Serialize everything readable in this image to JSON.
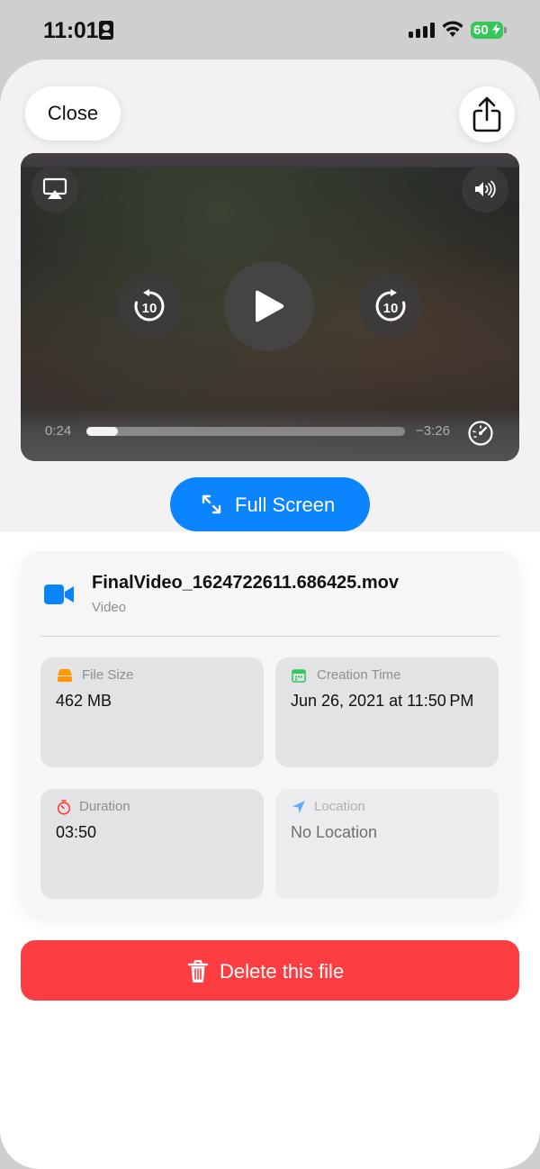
{
  "status_bar": {
    "time": "11:01",
    "battery": "60"
  },
  "header": {
    "close_label": "Close"
  },
  "player": {
    "current_time": "0:24",
    "remaining_time": "−3:26",
    "progress": 0.1,
    "skip_back_seconds": "10",
    "skip_forward_seconds": "10"
  },
  "fullscreen_label": "Full Screen",
  "file": {
    "name": "FinalVideo_1624722611.686425.mov",
    "type": "Video"
  },
  "info": {
    "file_size": {
      "label": "File Size",
      "value": "462 MB"
    },
    "creation_time": {
      "label": "Creation Time",
      "value": "Jun 26, 2021 at 11:50 PM"
    },
    "duration": {
      "label": "Duration",
      "value": "03:50"
    },
    "location": {
      "label": "Location",
      "value": "No Location"
    }
  },
  "delete_label": "Delete this file",
  "colors": {
    "accent": "#0a84ff",
    "danger": "#fc3d42",
    "file_size_icon": "#ff9500",
    "creation_icon": "#34c759",
    "duration_icon": "#ff3b30",
    "location_icon": "#0a84ff"
  },
  "icons": {
    "close": "",
    "share": "share-icon",
    "airplay": "airplay-icon",
    "volume": "speaker-icon",
    "skip_back": "skip-back-10-icon",
    "play": "play-icon",
    "skip_forward": "skip-forward-10-icon",
    "speed": "gauge-icon",
    "fullscreen": "expand-arrows-icon",
    "file": "video-camera-icon",
    "file_size": "drive-icon",
    "creation_time": "calendar-icon",
    "duration": "timer-icon",
    "location": "location-arrow-icon",
    "delete": "trash-icon"
  }
}
